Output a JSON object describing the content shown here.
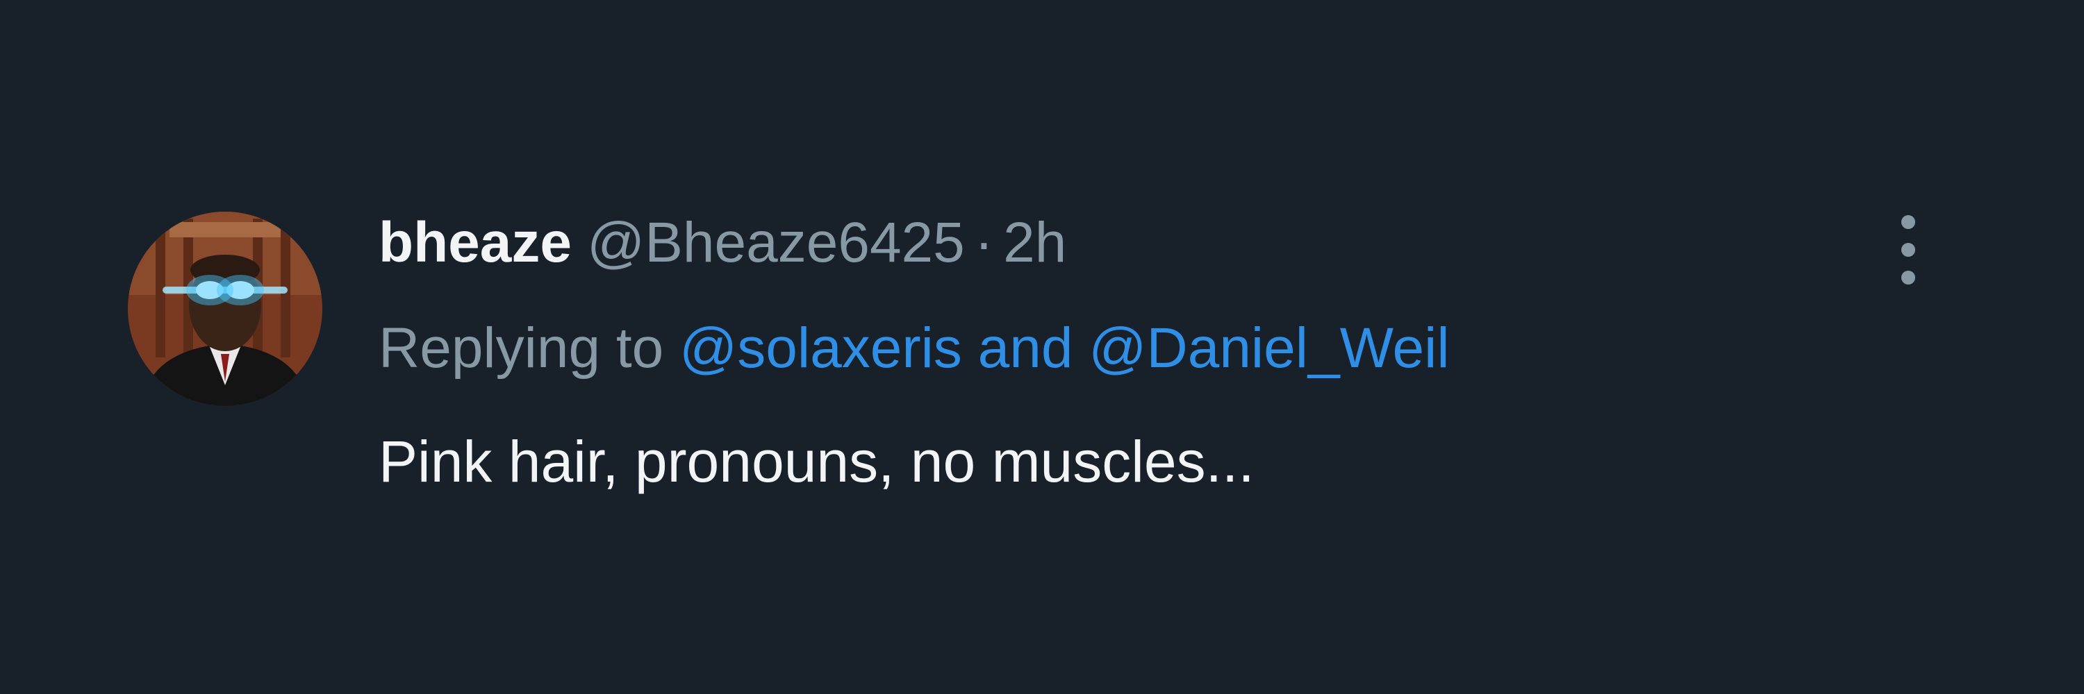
{
  "tweet": {
    "author": {
      "display_name": "bheaze",
      "handle": "@Bheaze6425",
      "avatar_icon": "profile-photo-avatar"
    },
    "separator": "·",
    "time_ago": "2h",
    "replying": {
      "prefix": "Replying to",
      "mention_1": "@solaxeris",
      "conjunction": "and",
      "mention_2": "@Daniel_Weil"
    },
    "text": "Pink hair, pronouns, no muscles...",
    "more_icon": "more-vertical-icon"
  },
  "colors": {
    "background": "#18202a",
    "primary_text": "#f2f4f6",
    "secondary_text": "#8899a6",
    "link": "#2f8ee6"
  }
}
